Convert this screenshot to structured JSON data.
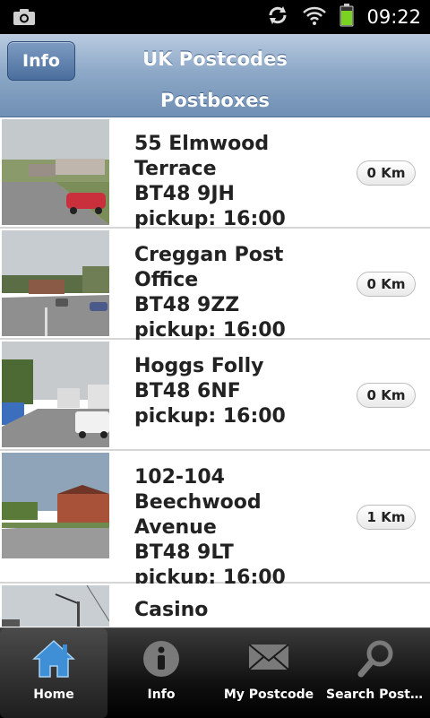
{
  "status_bar": {
    "time": "09:22"
  },
  "header": {
    "title": "UK Postcodes",
    "subtitle": "Postboxes",
    "info_label": "Info"
  },
  "postboxes": [
    {
      "name": "55 Elmwood Terrace",
      "postcode": "BT48 9JH",
      "pickup": "pickup: 16:00",
      "distance": "0 Km"
    },
    {
      "name": "Creggan Post Office",
      "postcode": "BT48 9ZZ",
      "pickup": "pickup: 16:00",
      "distance": "0 Km"
    },
    {
      "name": "Hoggs Folly",
      "postcode": "BT48 6NF",
      "pickup": "pickup: 16:00",
      "distance": "0 Km"
    },
    {
      "name": "102-104 Beechwood Avenue",
      "postcode": "BT48 9LT",
      "pickup": "pickup: 16:00",
      "distance": "1 Km"
    },
    {
      "name": "Casino"
    }
  ],
  "tabs": [
    {
      "label": "Home",
      "icon": "home-icon",
      "active": true
    },
    {
      "label": "Info",
      "icon": "info-icon",
      "active": false
    },
    {
      "label": "My Postcode",
      "icon": "envelope-icon",
      "active": false
    },
    {
      "label": "Search Postc...",
      "icon": "search-icon",
      "active": false
    }
  ],
  "colors": {
    "header": "#8ea9c8",
    "tabbar": "#111111",
    "accent": "#3f8fd6"
  }
}
